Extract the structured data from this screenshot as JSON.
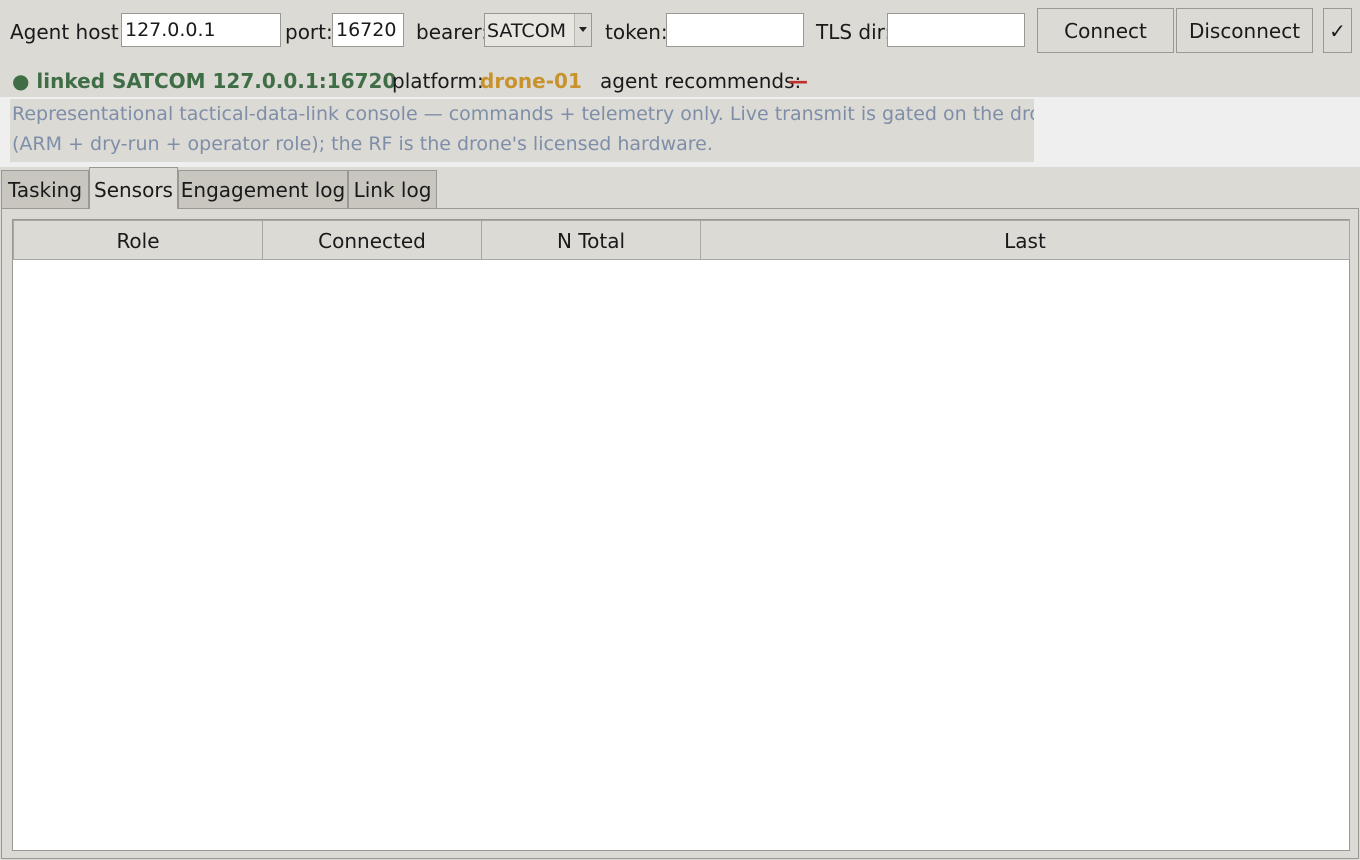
{
  "toolbar": {
    "agent_host_label": "Agent host:",
    "agent_host_value": "127.0.0.1",
    "port_label": "port:",
    "port_value": "16720",
    "bearer_label": "bearer:",
    "bearer_value": "SATCOM",
    "token_label": "token:",
    "token_value": "",
    "tls_label": "TLS dir:",
    "tls_value": "",
    "connect_label": "Connect",
    "disconnect_label": "Disconnect",
    "check_label": "✓"
  },
  "status": {
    "link_text": "● linked SATCOM 127.0.0.1:16720",
    "platform_label": "platform:",
    "platform_value": "drone-01",
    "recommend_label": "agent recommends:",
    "recommend_value": "—"
  },
  "notice": {
    "line1": "Representational tactical-data-link console — commands + telemetry only. Live transmit is gated on the drone",
    "line2": "(ARM + dry-run + operator role); the RF is the drone's licensed hardware."
  },
  "tabs": [
    {
      "label": "Tasking",
      "active": false
    },
    {
      "label": "Sensors",
      "active": true
    },
    {
      "label": "Engagement log",
      "active": false
    },
    {
      "label": "Link log",
      "active": false
    }
  ],
  "sensors_table": {
    "columns": [
      "Role",
      "Connected",
      "N Total",
      "Last"
    ],
    "rows": []
  },
  "colors": {
    "linked": "#3f6e46",
    "platform": "#c8932d",
    "recommend": "#c0302a",
    "notice_text": "#7e8ea8"
  }
}
